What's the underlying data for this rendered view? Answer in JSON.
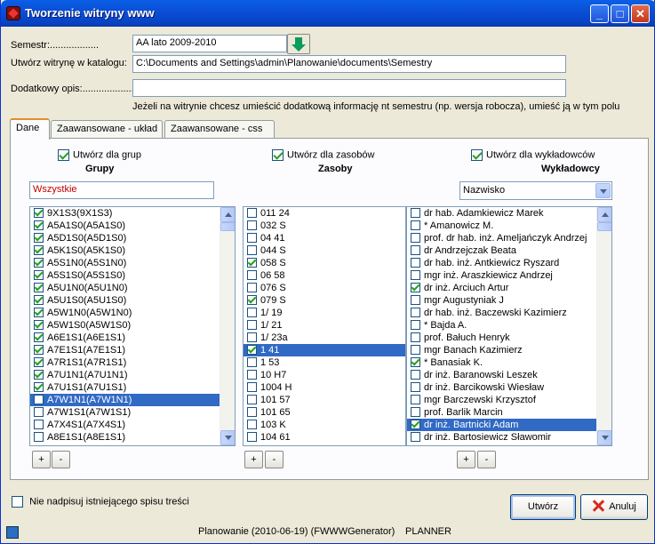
{
  "window": {
    "title": "Tworzenie witryny www",
    "min": "_",
    "max": "□",
    "close": "✕"
  },
  "form": {
    "semestr_label": "Semestr:..................",
    "semestr_value": "AA lato 2009-2010",
    "katalog_label": "Utwórz witrynę w katalogu:",
    "katalog_value": "C:\\Documents and Settings\\admin\\Planowanie\\documents\\Semestry",
    "opis_label": "Dodatkowy opis:...................",
    "opis_value": "",
    "hint": "Jeżeli na witrynie chcesz umieścić dodatkową informację nt semestru (np. wersja robocza), umieść ją w tym polu"
  },
  "tabs": [
    {
      "label": "Dane"
    },
    {
      "label": "Zaawansowane - układ"
    },
    {
      "label": "Zaawansowane - css"
    }
  ],
  "grupy": {
    "check_label": "Utwórz dla grup",
    "title": "Grupy",
    "filter": "Wszystkie",
    "items": [
      {
        "label": "9X1S3(9X1S3)",
        "checked": true
      },
      {
        "label": "A5A1S0(A5A1S0)",
        "checked": true
      },
      {
        "label": "A5D1S0(A5D1S0)",
        "checked": true
      },
      {
        "label": "A5K1S0(A5K1S0)",
        "checked": true
      },
      {
        "label": "A5S1N0(A5S1N0)",
        "checked": true
      },
      {
        "label": "A5S1S0(A5S1S0)",
        "checked": true
      },
      {
        "label": "A5U1N0(A5U1N0)",
        "checked": true
      },
      {
        "label": "A5U1S0(A5U1S0)",
        "checked": true
      },
      {
        "label": "A5W1N0(A5W1N0)",
        "checked": true
      },
      {
        "label": "A5W1S0(A5W1S0)",
        "checked": true
      },
      {
        "label": "A6E1S1(A6E1S1)",
        "checked": true
      },
      {
        "label": "A7E1S1(A7E1S1)",
        "checked": true
      },
      {
        "label": "A7R1S1(A7R1S1)",
        "checked": true
      },
      {
        "label": "A7U1N1(A7U1N1)",
        "checked": true
      },
      {
        "label": "A7U1S1(A7U1S1)",
        "checked": true
      },
      {
        "label": "A7W1N1(A7W1N1)",
        "checked": false,
        "selected": true
      },
      {
        "label": "A7W1S1(A7W1S1)",
        "checked": false
      },
      {
        "label": "A7X4S1(A7X4S1)",
        "checked": false
      },
      {
        "label": "A8E1S1(A8E1S1)",
        "checked": false
      }
    ]
  },
  "zasoby": {
    "check_label": "Utwórz dla zasobów",
    "title": "Zasoby",
    "items": [
      {
        "label": "011 24",
        "checked": false
      },
      {
        "label": "032 S",
        "checked": false
      },
      {
        "label": "04 41",
        "checked": false
      },
      {
        "label": "044 S",
        "checked": false
      },
      {
        "label": "058 S",
        "checked": true
      },
      {
        "label": "06 58",
        "checked": false
      },
      {
        "label": "076 S",
        "checked": false
      },
      {
        "label": "079 S",
        "checked": true
      },
      {
        "label": "1/ 19",
        "checked": false
      },
      {
        "label": "1/ 21",
        "checked": false
      },
      {
        "label": "1/ 23a",
        "checked": false
      },
      {
        "label": "1 41",
        "checked": true,
        "selected": true
      },
      {
        "label": "1 53",
        "checked": false
      },
      {
        "label": "10 H7",
        "checked": false
      },
      {
        "label": "1004 H",
        "checked": false
      },
      {
        "label": "101 57",
        "checked": false
      },
      {
        "label": "101 65",
        "checked": false
      },
      {
        "label": "103 K",
        "checked": false
      },
      {
        "label": "104 61",
        "checked": false
      }
    ]
  },
  "wykladowcy": {
    "check_label": "Utwórz dla wykładowców",
    "title": "Wykładowcy",
    "sort": "Nazwisko",
    "items": [
      {
        "label": "dr hab. Adamkiewicz Marek",
        "checked": false
      },
      {
        "label": "* Amanowicz M.",
        "checked": false
      },
      {
        "label": "prof. dr hab. inż. Ameljańczyk Andrzej",
        "checked": false
      },
      {
        "label": "dr Andrzejczak Beata",
        "checked": false
      },
      {
        "label": "dr hab. inż. Antkiewicz Ryszard",
        "checked": false
      },
      {
        "label": "mgr inż. Araszkiewicz Andrzej",
        "checked": false
      },
      {
        "label": "dr inż. Arciuch Artur",
        "checked": true
      },
      {
        "label": "mgr  Augustyniak J",
        "checked": false
      },
      {
        "label": "dr hab. inż. Baczewski Kazimierz",
        "checked": false
      },
      {
        "label": "* Bajda A.",
        "checked": false
      },
      {
        "label": "prof. Bałuch Henryk",
        "checked": false
      },
      {
        "label": "mgr Banach Kazimierz",
        "checked": false
      },
      {
        "label": "* Banasiak K.",
        "checked": true
      },
      {
        "label": "dr inż. Baranowski Leszek",
        "checked": false
      },
      {
        "label": "dr inż. Barcikowski Wiesław",
        "checked": false
      },
      {
        "label": "mgr Barczewski Krzysztof",
        "checked": false
      },
      {
        "label": "prof. Barlik Marcin",
        "checked": false
      },
      {
        "label": "dr inż. Bartnicki Adam",
        "checked": true,
        "selected": true
      },
      {
        "label": "dr inż. Bartosiewicz Sławomir",
        "checked": false
      }
    ]
  },
  "plus": "+",
  "minus": "-",
  "footer": {
    "nie_nadpisuj": "Nie nadpisuj istniejącego spisu treści",
    "utworz": "Utwórz",
    "anuluj": "Anuluj",
    "status1": "Planowanie (2010-06-19) (FWWWGenerator)",
    "status2": "PLANNER"
  }
}
